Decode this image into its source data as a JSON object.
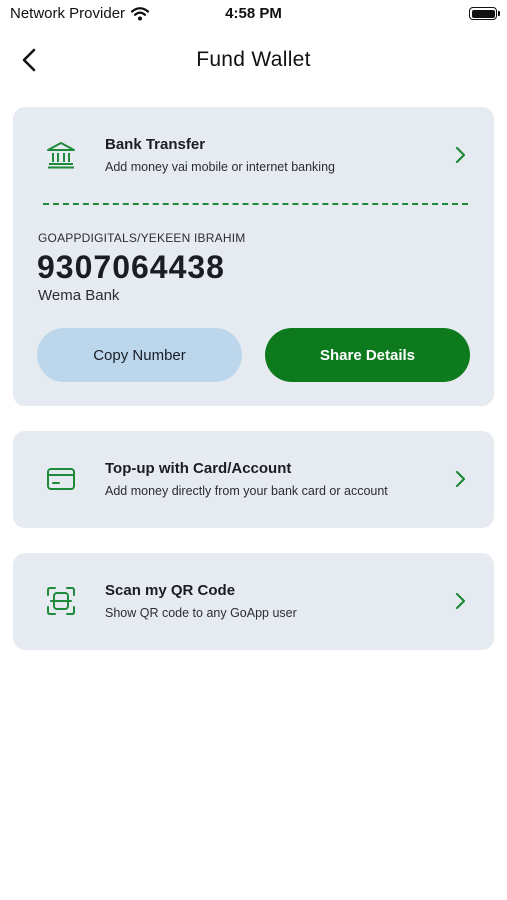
{
  "status_bar": {
    "carrier": "Network Provider",
    "time": "4:58 PM"
  },
  "nav": {
    "title": "Fund Wallet",
    "back_icon": "chevron-left-icon"
  },
  "bank_transfer": {
    "icon": "bank-icon",
    "title": "Bank Transfer",
    "subtitle": "Add money vai mobile or internet banking",
    "account_name": "GOAPPDIGITALS/YEKEEN IBRAHIM",
    "account_number": "9307064438",
    "bank_name": "Wema Bank",
    "copy_button": "Copy Number",
    "share_button": "Share Details"
  },
  "topup": {
    "icon": "card-icon",
    "title": "Top-up with Card/Account",
    "subtitle": "Add money directly from your bank card or account"
  },
  "qr": {
    "icon": "qr-scan-icon",
    "title": "Scan my QR Code",
    "subtitle": "Show QR code to any GoApp user"
  },
  "colors": {
    "accent": "#0d7a1e",
    "card_bg": "#e6ebf1",
    "copy_button_bg": "#bcd7ec"
  }
}
